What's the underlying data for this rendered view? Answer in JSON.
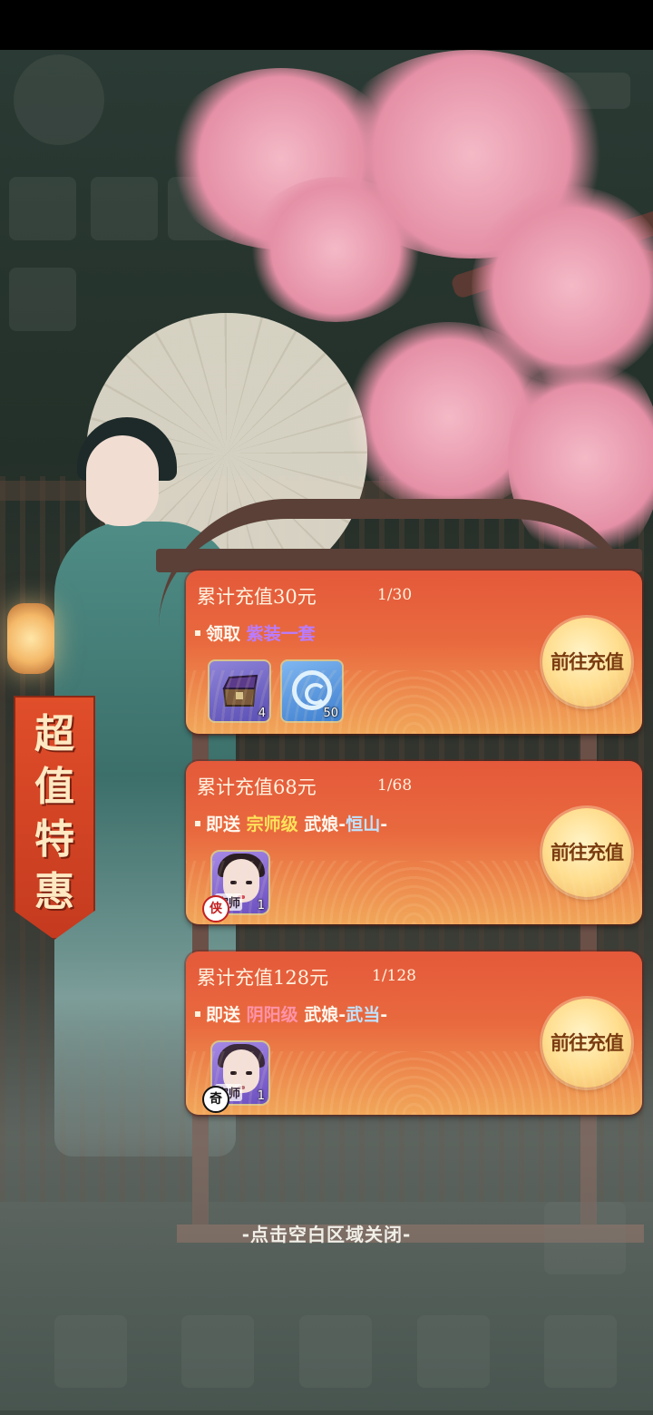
{
  "banner": {
    "text": "超值特惠"
  },
  "cards": [
    {
      "title": "累计充值30元",
      "progress": "1/30",
      "prefix": "领取",
      "highlight": "紫装一套",
      "items": [
        {
          "icon": "treasure-chest-icon",
          "count": "4"
        },
        {
          "icon": "blue-swirl-icon",
          "count": "50"
        }
      ],
      "button": "前往充值"
    },
    {
      "title": "累计充值68元",
      "progress": "1/68",
      "prefix": "即送",
      "highlight": "宗师级",
      "role": "武娘",
      "faction": "恒山",
      "portrait": {
        "badge": "侠",
        "rank": "宗师",
        "count": "1"
      },
      "button": "前往充值"
    },
    {
      "title": "累计充值128元",
      "progress": "1/128",
      "prefix": "即送",
      "highlight": "阴阳级",
      "role": "武娘",
      "faction": "武当",
      "portrait": {
        "badge": "奇",
        "rank": "宗师",
        "count": "1"
      },
      "button": "前往充值"
    }
  ],
  "close_hint": "-点击空白区域关闭-",
  "colors": {
    "card": "#e4593a",
    "button": "#ffde8f",
    "purple": "#b97cff",
    "gold": "#ffe35a",
    "pink": "#ff93a8",
    "blue": "#bfe3ff"
  }
}
